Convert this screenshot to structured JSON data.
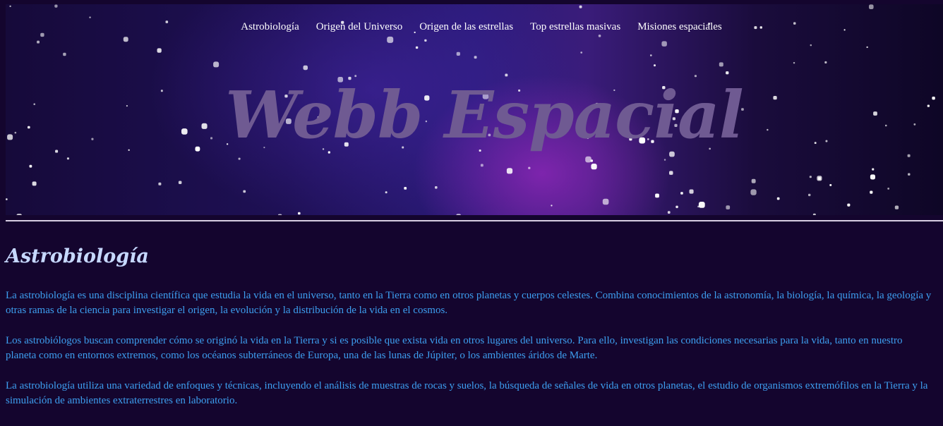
{
  "nav": {
    "items": [
      "Astrobiología",
      "Origen del Universo",
      "Origen de las estrellas",
      "Top estrellas masivas",
      "Misiones espaciales"
    ]
  },
  "header": {
    "site_title": "Webb Espacial"
  },
  "main": {
    "heading": "Astrobiología",
    "paragraphs": [
      "La astrobiología es una disciplina científica que estudia la vida en el universo, tanto en la Tierra como en otros planetas y cuerpos celestes. Combina conocimientos de la astronomía, la biología, la química, la geología y otras ramas de la ciencia para investigar el origen, la evolución y la distribución de la vida en el cosmos.",
      "Los astrobiólogos buscan comprender cómo se originó la vida en la Tierra y si es posible que exista vida en otros lugares del universo. Para ello, investigan las condiciones necesarias para la vida, tanto en nuestro planeta como en entornos extremos, como los océanos subterráneos de Europa, una de las lunas de Júpiter, o los ambientes áridos de Marte.",
      "La astrobiología utiliza una variedad de enfoques y técnicas, incluyendo el análisis de muestras de rocas y suelos, la búsqueda de señales de vida en otros planetas, el estudio de organismos extremófilos en la Tierra y la simulación de ambientes extraterrestres en laboratorio."
    ]
  },
  "colors": {
    "page_background": "#14052e",
    "title_color": "#6f5a92",
    "heading_color": "#c6d8ff",
    "paragraph_color": "#3d9ff0",
    "divider_color": "#d8cfe3"
  }
}
